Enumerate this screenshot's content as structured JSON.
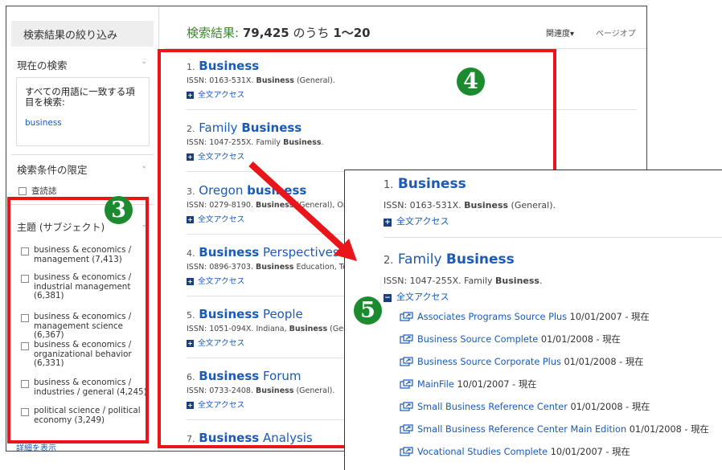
{
  "sidebar": {
    "title": "検索結果の絞り込み",
    "current_search": {
      "heading": "現在の検索",
      "label": "すべての用語に一致する項目を検索:",
      "term": "business"
    },
    "limit": {
      "heading": "検索条件の限定",
      "option": "查読誌"
    },
    "subject": {
      "heading": "主題 (サブジェクト)",
      "items": [
        "business & economics / management (7,413)",
        "business & economics / industrial management (6,381)",
        "business & economics / management science (6,367)",
        "business & economics / organizational behavior (6,331)",
        "business & economics / industries / general (4,245)",
        "political science / political economy (3,249)"
      ],
      "more": "詳細を表示"
    }
  },
  "results_header": {
    "label": "検索結果:",
    "count": "79,425",
    "of": "のうち",
    "range": "1〜20",
    "sort": "関連度▾",
    "page_options": "ページオプ"
  },
  "results": [
    {
      "num": "1.",
      "title_pre": "",
      "title_bold": "Business",
      "title_post": "",
      "meta_pre": "ISSN: 0163-531X. ",
      "meta_bold": "Business",
      "meta_post": " (General).",
      "fulltext": "全文アクセス"
    },
    {
      "num": "2.",
      "title_pre": "Family ",
      "title_bold": "Business",
      "title_post": "",
      "meta_pre": "ISSN: 1047-255X. Family ",
      "meta_bold": "Business",
      "meta_post": ".",
      "fulltext": "全文アクセス"
    },
    {
      "num": "3.",
      "title_pre": "Oregon ",
      "title_bold": "business",
      "title_post": "",
      "meta_pre": "ISSN: 0279-8190. ",
      "meta_bold": "Business",
      "meta_post": " (General), Or",
      "fulltext": "全文アクセス"
    },
    {
      "num": "4.",
      "title_pre": "",
      "title_bold": "Business",
      "title_post": " Perspectives",
      "meta_pre": "ISSN: 0896-3703. ",
      "meta_bold": "Business",
      "meta_post": " Education, Te",
      "fulltext": "全文アクセス"
    },
    {
      "num": "5.",
      "title_pre": "",
      "title_bold": "Business",
      "title_post": " People",
      "meta_pre": "ISSN: 1051-094X. Indiana, ",
      "meta_bold": "Business",
      "meta_post": " (Gen",
      "fulltext": "全文アクセス"
    },
    {
      "num": "6.",
      "title_pre": "",
      "title_bold": "Business",
      "title_post": " Forum",
      "meta_pre": "ISSN: 0733-2408. ",
      "meta_bold": "Business",
      "meta_post": " (General).",
      "fulltext": "全文アクセス"
    },
    {
      "num": "7.",
      "title_pre": "",
      "title_bold": "Business",
      "title_post": " Analysis",
      "meta_pre": "",
      "meta_bold": "",
      "meta_post": "",
      "fulltext": ""
    }
  ],
  "badges": {
    "three": "3",
    "four": "4",
    "five": "5"
  },
  "zoom": {
    "r1": {
      "num": "1.",
      "title": "Business",
      "meta_pre": "ISSN: 0163-531X. ",
      "meta_bold": "Business",
      "meta_post": " (General).",
      "fulltext": "全文アクセス"
    },
    "r2": {
      "num": "2.",
      "title_pre": "Family ",
      "title_bold": "Business",
      "meta_pre": "ISSN: 1047-255X. Family ",
      "meta_bold": "Business",
      "meta_post": ".",
      "fulltext": "全文アクセス"
    },
    "databases": [
      {
        "name": "Associates Programs Source Plus",
        "dates": " 10/01/2007 - 現在"
      },
      {
        "name": "Business Source Complete",
        "dates": " 01/01/2008 - 現在"
      },
      {
        "name": "Business Source Corporate Plus",
        "dates": " 01/01/2008 - 現在"
      },
      {
        "name": "MainFile",
        "dates": " 10/01/2007 - 現在"
      },
      {
        "name": "Small Business Reference Center",
        "dates": " 01/01/2008 - 現在"
      },
      {
        "name": "Small Business Reference Center Main Edition",
        "dates": " 01/01/2008 - 現在"
      },
      {
        "name": "Vocational Studies Complete",
        "dates": " 10/01/2007 - 現在"
      }
    ]
  },
  "colors": {
    "annotation_red": "#e8161b",
    "badge_green": "#1c8a2e",
    "link_blue": "#1a5ab8",
    "header_green": "#3a8a2a"
  }
}
